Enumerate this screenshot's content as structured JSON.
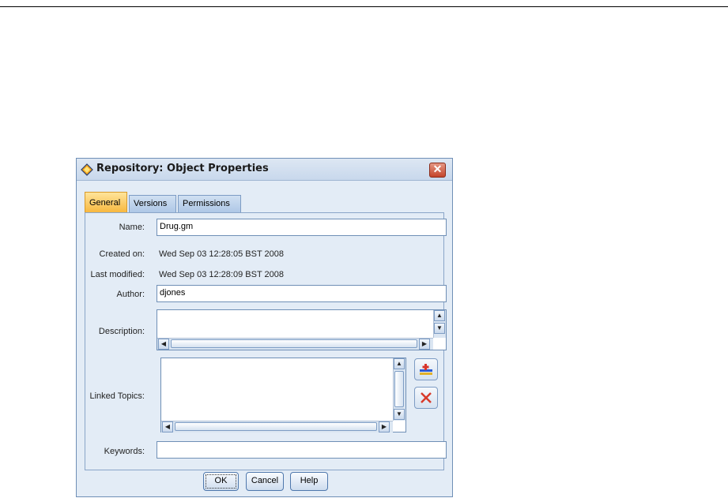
{
  "window": {
    "title": "Repository: Object Properties"
  },
  "tabs": [
    {
      "label": "General",
      "active": true
    },
    {
      "label": "Versions",
      "active": false
    },
    {
      "label": "Permissions",
      "active": false
    }
  ],
  "fields": {
    "name_label": "Name:",
    "name_value": "Drug.gm",
    "created_label": "Created on:",
    "created_value": "Wed Sep 03 12:28:05 BST 2008",
    "modified_label": "Last modified:",
    "modified_value": "Wed Sep 03 12:28:09 BST 2008",
    "author_label": "Author:",
    "author_value": "djones",
    "description_label": "Description:",
    "description_value": "",
    "linked_topics_label": "Linked Topics:",
    "keywords_label": "Keywords:",
    "keywords_value": ""
  },
  "icons": {
    "title": "diamond-app-icon",
    "close": "close-icon",
    "add_topic": "add-topic-icon",
    "remove_topic": "delete-icon"
  },
  "buttons": {
    "ok": "OK",
    "cancel": "Cancel",
    "help": "Help"
  },
  "colors": {
    "active_tab": "#f7b63c",
    "close_button": "#c4452b",
    "remove_icon": "#d83a2a"
  }
}
